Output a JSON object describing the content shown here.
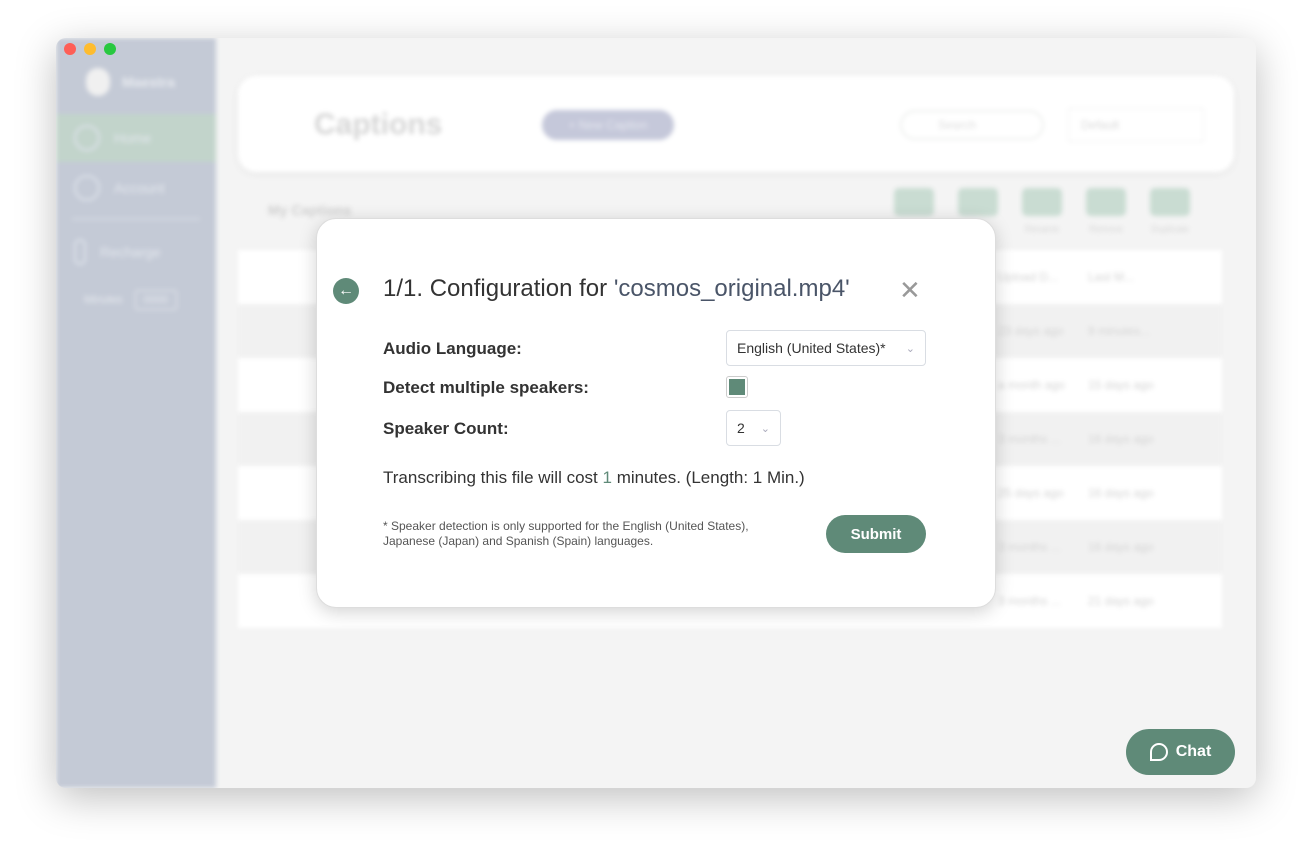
{
  "colors": {
    "accent": "#5f8a78",
    "sidebar": "#c4cad6"
  },
  "sidebar": {
    "brand": "Maestra",
    "items": [
      {
        "label": "Home",
        "icon": "home-icon"
      },
      {
        "label": "Account",
        "icon": "user-icon"
      },
      {
        "label": "Recharge",
        "icon": "recharge-icon"
      }
    ],
    "minutes_label": "Minutes",
    "minutes_value": "0000"
  },
  "header": {
    "title": "Captions",
    "new_button": "+ New Caption",
    "search_placeholder": "Search",
    "sort": "Default"
  },
  "list": {
    "title": "My Captions",
    "tools": [
      "",
      "",
      "Rename",
      "Remove",
      "Duplicate"
    ],
    "columns": [
      "Upload D...",
      "Last M..."
    ],
    "rows": [
      [
        "23 days ago",
        "9 minutes..."
      ],
      [
        "a month ago",
        "15 days ago"
      ],
      [
        "3 months ...",
        "16 days ago"
      ],
      [
        "25 days ago",
        "16 days ago"
      ],
      [
        "3 months ...",
        "16 days ago"
      ],
      [
        "3 months ...",
        "21 days ago"
      ]
    ]
  },
  "modal": {
    "title_prefix": "1/1. Configuration for ",
    "file_name": "'cosmos_original.mp4'",
    "audio_language_label": "Audio Language:",
    "audio_language_value": "English (United States)*",
    "detect_label": "Detect multiple speakers:",
    "detect_checked": true,
    "speaker_count_label": "Speaker Count:",
    "speaker_count_value": "2",
    "cost_prefix": "Transcribing this file will cost ",
    "cost_minutes": "1",
    "cost_suffix": " minutes. (Length: 1 Min.)",
    "note": "* Speaker detection is only supported for the English (United States), Japanese (Japan) and Spanish (Spain) languages.",
    "submit": "Submit"
  },
  "chat": {
    "label": "Chat"
  }
}
